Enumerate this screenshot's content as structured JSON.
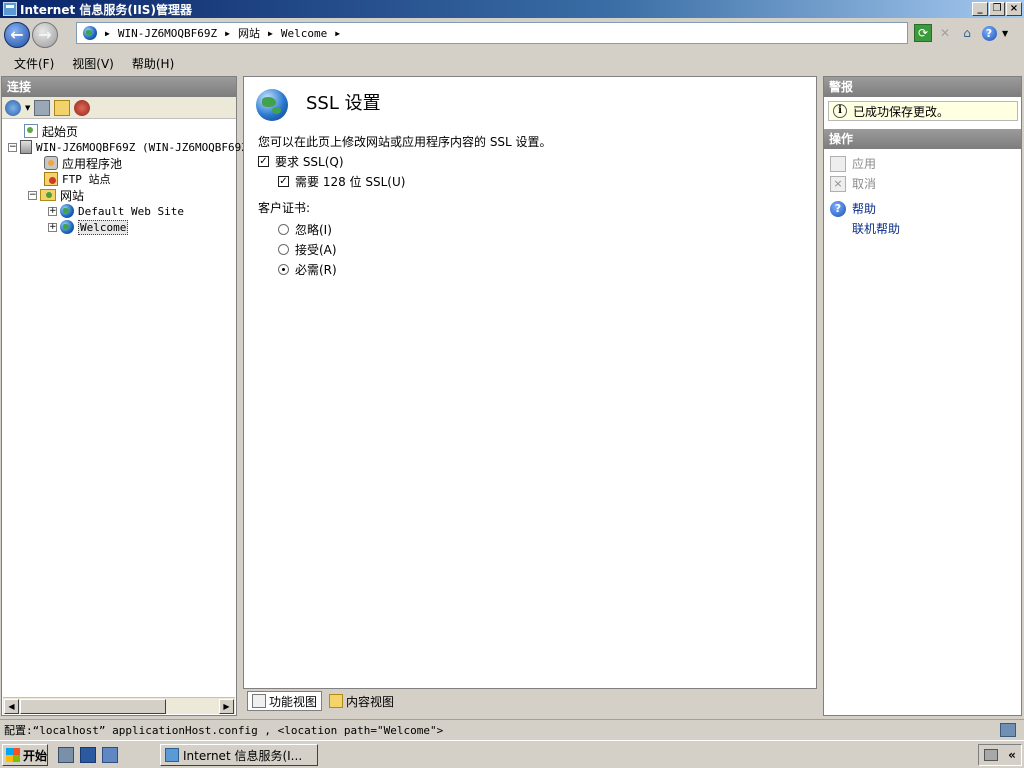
{
  "window": {
    "title": "Internet 信息服务(IIS)管理器"
  },
  "address": {
    "crumbs": [
      "WIN-JZ6MOQBF69Z",
      "网站",
      "Welcome"
    ]
  },
  "menu": {
    "file": "文件(F)",
    "view": "视图(V)",
    "help": "帮助(H)"
  },
  "connections": {
    "header": "连接",
    "tree": {
      "start_page": "起始页",
      "server": "WIN-JZ6MOQBF69Z (WIN-JZ6MOQBF69Z",
      "app_pools": "应用程序池",
      "ftp_sites": "FTP 站点",
      "sites": "网站",
      "default_site": "Default Web Site",
      "welcome_site": "Welcome"
    }
  },
  "content": {
    "title": "SSL 设置",
    "description": "您可以在此页上修改网站或应用程序内容的 SSL 设置。",
    "require_ssl": {
      "label": "要求 SSL(Q)",
      "checked": true
    },
    "require_128": {
      "label": "需要 128 位 SSL(U)",
      "checked": true
    },
    "client_cert_label": "客户证书:",
    "radio_ignore": {
      "label": "忽略(I)",
      "selected": false
    },
    "radio_accept": {
      "label": "接受(A)",
      "selected": false
    },
    "radio_require": {
      "label": "必需(R)",
      "selected": true
    }
  },
  "view_tabs": {
    "features": "功能视图",
    "content": "内容视图"
  },
  "alerts": {
    "header": "警报",
    "message": "已成功保存更改。"
  },
  "actions": {
    "header": "操作",
    "apply": "应用",
    "cancel": "取消",
    "help": "帮助",
    "online_help": "联机帮助"
  },
  "status": {
    "text": "配置:“localhost” applicationHost.config , <location path=\"Welcome\">"
  },
  "taskbar": {
    "start": "开始",
    "task_title": "Internet 信息服务(I..."
  },
  "icons": [
    "back-arrow-icon",
    "forward-arrow-icon",
    "globe-icon",
    "refresh-icon",
    "stop-icon",
    "home-icon",
    "help-icon",
    "windows-logo-icon"
  ]
}
